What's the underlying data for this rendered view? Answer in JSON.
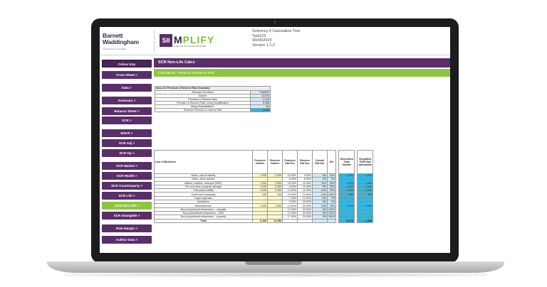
{
  "header": {
    "brand": [
      "Barnett",
      "Waddingham"
    ],
    "brand_tagline": "CONSULTING ACTUARIES",
    "product_box": "SII",
    "product_word_a": "M",
    "product_word_b": "PLIFY",
    "product_tagline": "A PILLAR TO PILLAR SOLUTION",
    "info_lines": [
      "Solvency II Calculation Tool",
      "Test123",
      "30/09/2015",
      "Version 1.1.2"
    ]
  },
  "sidebar": {
    "items": [
      {
        "label": "Colour Key",
        "kind": "key"
      },
      {
        "label": "Front Sheet >",
        "kind": ""
      },
      {
        "label": "Data >",
        "kind": ""
      },
      {
        "label": "Summary >",
        "kind": ""
      },
      {
        "label": "Balance Sheet >",
        "kind": ""
      },
      {
        "label": "SCR >",
        "kind": ""
      },
      {
        "label": "BSCR >",
        "kind": ""
      },
      {
        "label": "SCR Adj >",
        "kind": ""
      },
      {
        "label": "SCR Op >",
        "kind": ""
      },
      {
        "label": "SCR Market >",
        "kind": ""
      },
      {
        "label": "SCR Health >",
        "kind": ""
      },
      {
        "label": "SCR Counterparty >",
        "kind": ""
      },
      {
        "label": "SCR Life >",
        "kind": ""
      },
      {
        "label": "SCR Non-Life >",
        "kind": "active"
      },
      {
        "label": "SCR Intangible >",
        "kind": ""
      },
      {
        "label": "Risk Margin >",
        "kind": ""
      },
      {
        "label": "Author Data >",
        "kind": ""
      }
    ]
  },
  "main": {
    "title": "SCR Non-Life Calcs",
    "subtitle": "Calculations - Premium & Reserve Risk",
    "summary": {
      "heading": "Non-Life Premium & Reserve Risk Summary",
      "rows": [
        {
          "label": "Standard Deviation",
          "value": "7.6653%"
        },
        {
          "label": "Volume",
          "value": "14,575"
        },
        {
          "label": "Premium & Reserve Risk",
          "value": "3,440"
        },
        {
          "label": "Premium & Reserve Risk, using Simplification",
          "value": "8,358"
        },
        {
          "label": "Using Simplification?",
          "value": "No"
        },
        {
          "label": "Selected Premium & reserve Risk",
          "value": "3,440"
        }
      ]
    },
    "table": {
      "headers": [
        "Line of Business",
        "Premium Volume",
        "Reserve Volume",
        "Premium Std Dev",
        "Reserve Std Dev",
        "Overall Std Dev",
        "DIV",
        "Diversified Total Volume",
        "Simplified P&R Risk calculation"
      ],
      "rows": [
        [
          "Motor, vehicle liability",
          "1,200",
          "2,250",
          "10.00%",
          "9.00%",
          "9%",
          "33%",
          "2,971",
          "1,020"
        ],
        [
          "Motor, other classes",
          "-",
          "-",
          "8.00%",
          "8.00%",
          "0%",
          "0%",
          "-",
          "-"
        ],
        [
          "Marine, aviation, transport (MAT)",
          "1,200",
          "2,250",
          "15.00%",
          "11.00%",
          "11%",
          "33%",
          "2,675",
          "1,020"
        ],
        [
          "Fire and other property damage",
          "1,200",
          "2,250",
          "8.00%",
          "10.00%",
          "9%",
          "33%",
          "2,675",
          "1,020"
        ],
        [
          "Third-party liability",
          "1,200",
          "2,250",
          "14.00%",
          "11.00%",
          "10%",
          "33%",
          "2,675",
          "1,020"
        ],
        [
          "Credit and suretyship",
          "100",
          "100",
          "12.00%",
          "19.00%",
          "14%",
          "100%",
          "200",
          "104"
        ],
        [
          "Legal expenses",
          "-",
          "-",
          "7.00%",
          "12.00%",
          "0%",
          "0%",
          "-",
          "-"
        ],
        [
          "Assistance",
          "-",
          "-",
          "9.00%",
          "20.00%",
          "0%",
          "0%",
          "-",
          "-"
        ],
        [
          "Miscellaneous",
          "1,200",
          "2,250",
          "13.00%",
          "20.00%",
          "16%",
          "33%",
          "2,675",
          "1,020"
        ],
        [
          "Non-proportional reinsurance – casualty",
          "-",
          "-",
          "17.00%",
          "20.00%",
          "0%",
          "100%",
          "-",
          "-"
        ],
        [
          "Non-proportional reinsurance – MAT",
          "-",
          "-",
          "17.00%",
          "20.00%",
          "0%",
          "100%",
          "-",
          "-"
        ],
        [
          "Non-proportional reinsurance – property",
          "-",
          "-",
          "17.00%",
          "20.00%",
          "0%",
          "100%",
          "-",
          "-"
        ]
      ],
      "total": [
        "Total",
        "6,100",
        "11,350",
        "",
        "",
        "",
        "",
        "14,575",
        "6,358"
      ]
    }
  }
}
